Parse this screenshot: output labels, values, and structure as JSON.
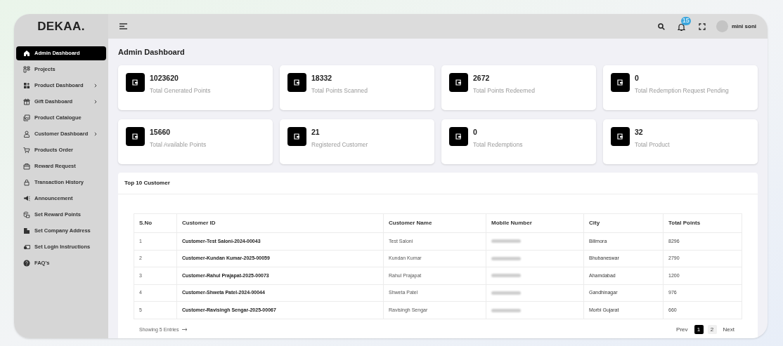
{
  "logo": "DEKAA.",
  "sidebar": {
    "items": [
      {
        "label": "Admin Dashboard",
        "selected": true,
        "submenu": false
      },
      {
        "label": "Projects",
        "selected": false,
        "submenu": false
      },
      {
        "label": "Product Dashboard",
        "selected": false,
        "submenu": true
      },
      {
        "label": "Gift Dashboard",
        "selected": false,
        "submenu": true
      },
      {
        "label": "Product Catalogue",
        "selected": false,
        "submenu": false
      },
      {
        "label": "Customer Dashboard",
        "selected": false,
        "submenu": true
      },
      {
        "label": "Products Order",
        "selected": false,
        "submenu": false
      },
      {
        "label": "Reward Request",
        "selected": false,
        "submenu": false
      },
      {
        "label": "Transaction History",
        "selected": false,
        "submenu": false
      },
      {
        "label": "Announcement",
        "selected": false,
        "submenu": false
      },
      {
        "label": "Set Reward Points",
        "selected": false,
        "submenu": false
      },
      {
        "label": "Set Company Address",
        "selected": false,
        "submenu": false
      },
      {
        "label": "Set Login Instructions",
        "selected": false,
        "submenu": false
      },
      {
        "label": "FAQ's",
        "selected": false,
        "submenu": false
      }
    ]
  },
  "topbar": {
    "notification_count": "15",
    "user_name": "mini soni"
  },
  "page_title": "Admin Dashboard",
  "stats": [
    {
      "value": "1023620",
      "label": "Total Generated Points"
    },
    {
      "value": "18332",
      "label": "Total Points Scanned"
    },
    {
      "value": "2672",
      "label": "Total Points Redeemed"
    },
    {
      "value": "0",
      "label": "Total Redemption Request Pending"
    },
    {
      "value": "15660",
      "label": "Total Available Points"
    },
    {
      "value": "21",
      "label": "Registered Customer"
    },
    {
      "value": "0",
      "label": "Total Redemptions"
    },
    {
      "value": "32",
      "label": "Total Product"
    }
  ],
  "table": {
    "title": "Top 10 Customer",
    "columns": [
      "S.No",
      "Customer ID",
      "Customer Name",
      "Mobile Number",
      "City",
      "Total Points"
    ],
    "rows": [
      {
        "sno": "1",
        "customer_id": "Customer-Test Saloni-2024-00043",
        "name": "Test Saloni",
        "city": "Bilimora",
        "points": "8296"
      },
      {
        "sno": "2",
        "customer_id": "Customer-Kundan Kumar-2025-00059",
        "name": "Kundan Kumar",
        "city": "Bhubaneswar",
        "points": "2790"
      },
      {
        "sno": "3",
        "customer_id": "Customer-Rahul Prajapat-2025-00073",
        "name": "Rahul Prajapat",
        "city": "Ahamdabad",
        "points": "1200"
      },
      {
        "sno": "4",
        "customer_id": "Customer-Shweta Patel-2024-00044",
        "name": "Shweta Patel",
        "city": "Gandhinagar",
        "points": "976"
      },
      {
        "sno": "5",
        "customer_id": "Customer-Ravisingh Sengar-2025-00067",
        "name": "Ravisingh Sengar",
        "city": "Morbi Gujarat",
        "points": "660"
      }
    ],
    "footer": "Showing 5 Entries",
    "pagination": {
      "prev": "Prev",
      "pages": [
        {
          "label": "1",
          "selected": true
        },
        {
          "label": "2",
          "selected": false
        }
      ],
      "next": "Next"
    }
  }
}
